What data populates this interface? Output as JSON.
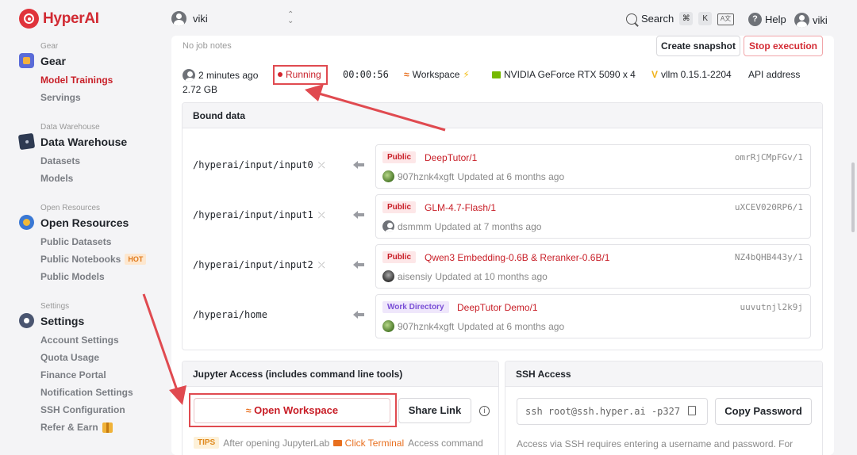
{
  "brand": {
    "name": "HyperAI",
    "color": "#d12a33"
  },
  "header": {
    "user": "viki",
    "search_label": "Search",
    "shortcut_keys": [
      "⌘",
      "K"
    ],
    "help_label": "Help",
    "account_name": "viki"
  },
  "sidebar": {
    "sections": [
      {
        "small": "Gear",
        "title": "Gear",
        "icon": "gear-box-icon",
        "items": [
          {
            "label": "Model Trainings",
            "active": true
          },
          {
            "label": "Servings"
          }
        ]
      },
      {
        "small": "Data Warehouse",
        "title": "Data Warehouse",
        "icon": "database-icon",
        "items": [
          {
            "label": "Datasets"
          },
          {
            "label": "Models"
          }
        ]
      },
      {
        "small": "Open Resources",
        "title": "Open Resources",
        "icon": "globe-icon",
        "items": [
          {
            "label": "Public Datasets"
          },
          {
            "label": "Public Notebooks",
            "badge": "HOT"
          },
          {
            "label": "Public Models"
          }
        ]
      },
      {
        "small": "Settings",
        "title": "Settings",
        "icon": "settings-gear-icon",
        "items": [
          {
            "label": "Account Settings"
          },
          {
            "label": "Quota Usage"
          },
          {
            "label": "Finance Portal"
          },
          {
            "label": "Notification Settings"
          },
          {
            "label": "SSH Configuration"
          },
          {
            "label": "Refer & Earn",
            "gift": true
          }
        ]
      }
    ]
  },
  "job": {
    "notes": "No job notes",
    "snapshot_label": "Create snapshot",
    "stop_label": "Stop execution",
    "time_ago": "2 minutes ago",
    "status": "Running",
    "duration": "00:00:56",
    "workspace": "Workspace",
    "gpu": "NVIDIA GeForce RTX 5090 x 4",
    "framework": "vllm 0.15.1-2204",
    "api": "API address",
    "memory": "2.72 GB"
  },
  "bound": {
    "title": "Bound data",
    "rows": [
      {
        "path": "/hyperai/input/input0",
        "tag": "Public",
        "name": "DeepTutor/1",
        "id": "omrRjCMpFGv/1",
        "owner": "907hznk4xgft",
        "updated": "Updated at 6 months ago",
        "avatar": "green"
      },
      {
        "path": "/hyperai/input/input1",
        "tag": "Public",
        "name": "GLM-4.7-Flash/1",
        "id": "uXCEV020RP6/1",
        "owner": "dsmmm",
        "updated": "Updated at 7 months ago",
        "avatar": "grey"
      },
      {
        "path": "/hyperai/input/input2",
        "tag": "Public",
        "name": "Qwen3 Embedding-0.6B & Reranker-0.6B/1",
        "id": "NZ4bQHB443y/1",
        "owner": "aisensiy",
        "updated": "Updated at 10 months ago",
        "avatar": "dark"
      },
      {
        "path": "/hyperai/home",
        "tag": "Work Directory",
        "name": "DeepTutor Demo/1",
        "id": "uuvutnjl2k9j",
        "owner": "907hznk4xgft",
        "updated": "Updated at 6 months ago",
        "avatar": "green"
      }
    ]
  },
  "jupyter": {
    "title": "Jupyter Access (includes command line tools)",
    "open_label": "Open Workspace",
    "share_label": "Share Link",
    "tips_tag": "TIPS",
    "tips_before": "After opening JupyterLab",
    "tips_link": "Click Terminal",
    "tips_after": "Access command"
  },
  "ssh": {
    "title": "SSH Access",
    "command": "ssh root@ssh.hyper.ai -p327",
    "copy_label": "Copy Password",
    "note": "Access via SSH requires entering a username and password. For"
  },
  "colors": {
    "accent": "#c81e27",
    "annotation": "#e04a50"
  }
}
